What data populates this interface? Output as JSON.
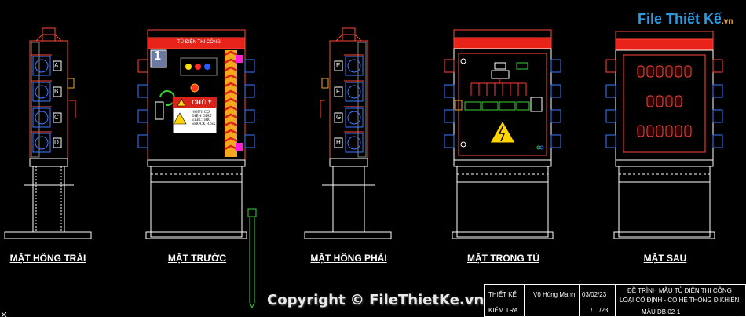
{
  "front": {
    "header": "TỦ ĐIỆN THI CÔNG",
    "panel_number": "1",
    "caution_title": "CHÚ Ý",
    "caution_text": "NGUY CƠ ĐIỆN GIẬT ELECTRIC SHOCK RISK"
  },
  "sockets": {
    "left": [
      "A",
      "B",
      "C",
      "D"
    ],
    "right": [
      "E",
      "F",
      "G",
      "H"
    ]
  },
  "views": [
    "MẶT HÔNG TRÁI",
    "MẶT TRƯỚC",
    "MẶT HÔNG PHẢI",
    "MẶT TRONG TỦ",
    "MẶT SAU"
  ],
  "logo": {
    "main": "File Thiết Kế",
    "suffix": ".vn"
  },
  "copyright": "Copyright © FileThietKe.vn",
  "title_block": {
    "designed_label": "THIẾT KẾ",
    "designer": "Võ Hùng Mạnh",
    "date": "03/02/23",
    "checked_label": "KIỂM TRA",
    "check_date": "...../..../23",
    "title_line1": "ĐỀ TRÌNH MẪU TỦ ĐIỆN THI CÔNG",
    "title_line2": "LOẠI CỐ ĐỊNH - CÓ HỆ THỐNG Đ.KHIỂN",
    "model": "MẪU DB.02-1"
  },
  "colors": {
    "background": "#000000",
    "cabinet_outline": "#ff4a3a",
    "socket_blue": "#3a7bff",
    "accent_green": "#3ad13a",
    "hazard_yellow": "#ffd400"
  }
}
